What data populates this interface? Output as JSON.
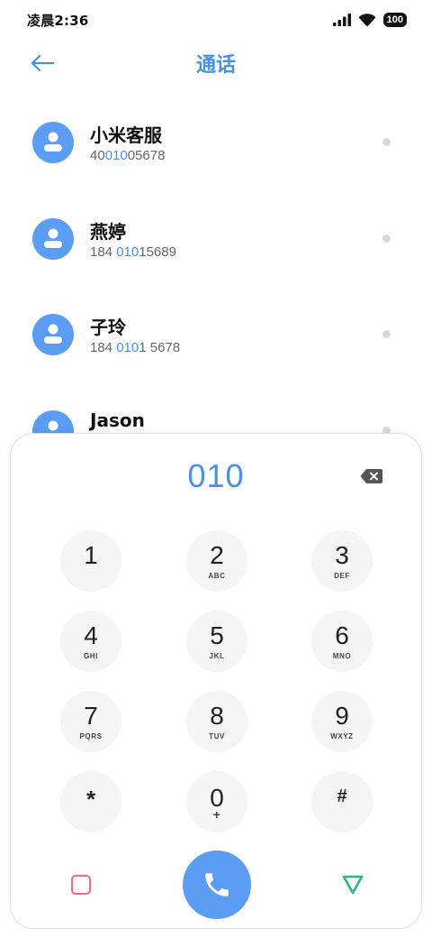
{
  "status_bar": {
    "time": "凌晨2:36",
    "battery": "100"
  },
  "header": {
    "title": "通话",
    "back_icon": "arrow-left-icon"
  },
  "contacts": [
    {
      "name": "小米客服",
      "number_parts": [
        "40",
        "010",
        "05678"
      ]
    },
    {
      "name": "燕婷",
      "number_parts": [
        "184 ",
        "010",
        "15689"
      ]
    },
    {
      "name": "子玲",
      "number_parts": [
        "184 ",
        "010",
        "1 5678"
      ]
    },
    {
      "name": "Jason",
      "number_parts": [
        "",
        "",
        ""
      ]
    }
  ],
  "dialpad": {
    "input": "010",
    "keys": [
      {
        "digit": "1",
        "letters": ""
      },
      {
        "digit": "2",
        "letters": "ABC"
      },
      {
        "digit": "3",
        "letters": "DEF"
      },
      {
        "digit": "4",
        "letters": "GHI"
      },
      {
        "digit": "5",
        "letters": "JKL"
      },
      {
        "digit": "6",
        "letters": "MNO"
      },
      {
        "digit": "7",
        "letters": "PQRS"
      },
      {
        "digit": "8",
        "letters": "TUV"
      },
      {
        "digit": "9",
        "letters": "WXYZ"
      },
      {
        "digit": "*",
        "letters": ""
      },
      {
        "digit": "0",
        "letters": "+"
      },
      {
        "digit": "#",
        "letters": ""
      }
    ]
  },
  "colors": {
    "accent": "#4a90e2",
    "avatar": "#5b9cf5",
    "key_bg": "#f5f5f5",
    "square_button": "#f06b7d",
    "collapse_button": "#2bb58a"
  }
}
